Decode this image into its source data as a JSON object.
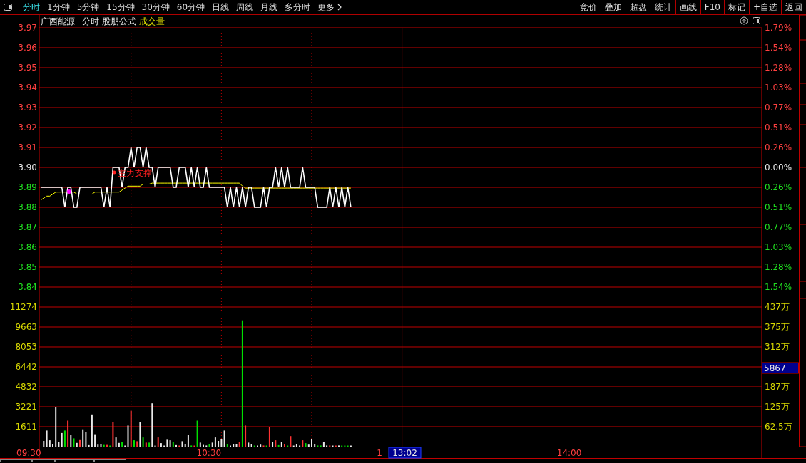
{
  "toolbar": {
    "tabs": [
      {
        "label": "分时",
        "selected": true
      },
      {
        "label": "1分钟",
        "selected": false
      },
      {
        "label": "5分钟",
        "selected": false
      },
      {
        "label": "15分钟",
        "selected": false
      },
      {
        "label": "30分钟",
        "selected": false
      },
      {
        "label": "60分钟",
        "selected": false
      },
      {
        "label": "日线",
        "selected": false
      },
      {
        "label": "周线",
        "selected": false
      },
      {
        "label": "月线",
        "selected": false
      },
      {
        "label": "多分时",
        "selected": false
      }
    ],
    "more": "更多",
    "buttons": [
      "竞价",
      "叠加",
      "超盘",
      "统计",
      "画线",
      "F10",
      "标记",
      "+自选",
      "返回"
    ]
  },
  "chart_header": [
    {
      "text": "广西能源",
      "kind": "title"
    },
    {
      "text": "分时",
      "kind": "label"
    },
    {
      "text": "股朋公式",
      "kind": "label"
    },
    {
      "text": "成交量",
      "kind": "indicator"
    }
  ],
  "price_chart": {
    "chart_data": {
      "type": "line",
      "grid": true,
      "ylim": [
        3.84,
        3.97
      ],
      "categories": [
        null,
        null,
        null,
        null,
        null,
        null,
        null,
        null,
        null,
        null,
        null,
        null,
        null,
        null,
        null,
        null,
        null,
        null,
        null,
        null,
        null,
        null,
        null,
        null,
        null,
        null,
        null,
        null,
        null,
        null,
        null,
        null,
        null,
        null,
        null,
        null,
        null,
        null,
        null,
        null,
        null,
        null,
        null,
        null,
        null,
        null,
        null,
        null,
        null,
        null,
        null,
        null,
        null,
        null,
        null,
        null,
        null,
        null,
        null,
        null,
        null,
        null,
        null,
        null,
        null,
        null,
        null,
        null,
        null,
        null,
        null,
        null,
        null,
        null,
        null,
        null,
        null,
        null,
        null,
        null,
        null,
        null,
        null,
        null,
        null,
        null,
        null,
        null,
        null,
        null,
        null,
        null,
        null,
        null,
        null,
        null,
        null,
        null,
        null,
        null,
        null,
        null,
        null,
        null,
        null,
        null,
        null,
        null,
        null,
        null,
        null,
        null,
        null,
        null,
        null,
        null,
        null,
        null,
        null,
        null,
        null,
        null,
        null,
        null,
        null,
        null,
        null,
        null,
        null,
        null,
        null,
        null,
        null,
        null,
        null,
        null,
        null,
        null,
        null,
        null,
        null,
        null,
        null,
        null,
        null,
        null,
        null,
        null,
        null,
        null,
        null,
        null,
        null,
        null,
        null,
        null,
        null,
        null,
        null,
        null,
        null,
        null,
        null,
        null,
        null,
        null,
        null,
        null,
        null,
        null,
        null,
        null,
        null,
        null,
        null,
        null,
        null,
        null,
        null,
        null,
        null,
        null,
        null,
        null,
        null,
        null,
        null,
        null,
        null,
        null,
        null,
        null,
        null,
        null,
        null,
        null,
        null,
        null,
        null,
        null,
        null,
        null,
        null,
        null,
        null,
        null,
        null,
        null,
        null,
        null,
        null,
        null,
        null,
        null,
        null,
        null,
        null,
        null,
        null,
        null,
        null,
        null,
        null,
        null,
        null,
        null,
        null,
        null,
        null,
        null,
        null,
        null,
        null,
        null,
        null,
        null,
        null,
        null,
        null,
        null
      ],
      "series": [
        {
          "color": "#ffffff",
          "values": [
            3.89,
            3.89,
            3.89,
            3.89,
            3.89,
            3.89,
            3.89,
            3.89,
            3.88,
            3.89,
            3.89,
            3.88,
            3.88,
            3.89,
            3.89,
            3.89,
            3.89,
            3.89,
            3.89,
            3.89,
            3.89,
            3.88,
            3.89,
            3.88,
            3.9,
            3.9,
            3.9,
            3.89,
            3.9,
            3.9,
            3.91,
            3.9,
            3.91,
            3.91,
            3.9,
            3.91,
            3.9,
            3.9,
            3.89,
            3.9,
            3.9,
            3.9,
            3.9,
            3.9,
            3.89,
            3.89,
            3.9,
            3.9,
            3.9,
            3.89,
            3.9,
            3.89,
            3.9,
            3.89,
            3.89,
            3.9,
            3.89,
            3.89,
            3.89,
            3.89,
            3.89,
            3.89,
            3.88,
            3.89,
            3.88,
            3.89,
            3.88,
            3.89,
            3.88,
            3.89,
            3.89,
            3.88,
            3.88,
            3.88,
            3.89,
            3.88,
            3.89,
            3.89,
            3.9,
            3.89,
            3.9,
            3.89,
            3.9,
            3.89,
            3.89,
            3.89,
            3.89,
            3.9,
            3.89,
            3.89,
            3.89,
            3.89,
            3.88,
            3.88,
            3.88,
            3.88,
            3.89,
            3.88,
            3.89,
            3.88,
            3.89,
            3.88,
            3.89,
            3.88,
            null,
            null,
            null,
            null,
            null,
            null,
            null,
            null,
            null,
            null,
            null,
            null,
            null,
            null,
            null,
            null,
            null,
            null,
            null,
            null,
            null,
            null,
            null,
            null,
            null,
            null,
            null,
            null,
            null,
            null,
            null,
            null,
            null,
            null,
            null,
            null,
            null,
            null,
            null,
            null,
            null,
            null,
            null,
            null,
            null,
            null,
            null,
            null,
            null,
            null,
            null,
            null,
            null,
            null,
            null,
            null,
            null,
            null,
            null,
            null,
            null,
            null,
            null,
            null,
            null,
            null,
            null,
            null,
            null,
            null,
            null,
            null,
            null,
            null,
            null,
            null,
            null,
            null,
            null,
            null,
            null,
            null,
            null,
            null,
            null,
            null,
            null,
            null,
            null,
            null,
            null,
            null,
            null,
            null,
            null,
            null,
            null,
            null,
            null,
            null,
            null,
            null,
            null,
            null,
            null,
            null,
            null,
            null,
            null,
            null,
            null,
            null,
            null,
            null,
            null,
            null,
            null,
            null,
            null,
            null,
            null,
            null,
            null,
            null,
            null,
            null,
            null,
            null,
            null,
            null,
            null,
            null,
            null,
            null,
            null,
            null
          ]
        },
        {
          "color": "#ffff00",
          "values": [
            3.884,
            3.885,
            3.886,
            3.886,
            3.887,
            3.888,
            3.888,
            3.888,
            3.888,
            3.888,
            3.888,
            3.888,
            3.887,
            3.887,
            3.887,
            3.887,
            3.887,
            3.887,
            3.888,
            3.888,
            3.888,
            3.888,
            3.888,
            3.888,
            3.888,
            3.888,
            3.888,
            3.889,
            3.89,
            3.891,
            3.891,
            3.891,
            3.891,
            3.891,
            3.892,
            3.892,
            3.892,
            3.8925,
            3.8925,
            3.8925,
            3.8925,
            3.8925,
            3.8925,
            3.8925,
            3.8925,
            3.8925,
            3.8925,
            3.8925,
            3.8925,
            3.8925,
            3.8925,
            3.8925,
            3.8925,
            3.8925,
            3.8925,
            3.8925,
            3.8925,
            3.8925,
            3.8925,
            3.8925,
            3.8925,
            3.8925,
            3.8925,
            3.8925,
            3.8925,
            3.8925,
            3.8925,
            3.891,
            3.89,
            3.89,
            3.89,
            3.89,
            3.89,
            3.89,
            3.89,
            3.89,
            3.89,
            3.89,
            3.89,
            3.89,
            3.89,
            3.89,
            3.89,
            3.89,
            3.89,
            3.89,
            3.89,
            3.89,
            3.89,
            3.89,
            3.89,
            3.89,
            3.89,
            3.89,
            3.89,
            3.89,
            3.89,
            3.89,
            3.89,
            3.89,
            3.89,
            3.89,
            3.89,
            3.89,
            null,
            null,
            null,
            null,
            null,
            null,
            null,
            null,
            null,
            null,
            null,
            null,
            null,
            null,
            null,
            null,
            null,
            null,
            null,
            null,
            null,
            null,
            null,
            null,
            null,
            null,
            null,
            null,
            null,
            null,
            null,
            null,
            null,
            null,
            null,
            null,
            null,
            null,
            null,
            null,
            null,
            null,
            null,
            null,
            null,
            null,
            null,
            null,
            null,
            null,
            null,
            null,
            null,
            null,
            null,
            null,
            null,
            null,
            null,
            null,
            null,
            null,
            null,
            null,
            null,
            null,
            null,
            null,
            null,
            null,
            null,
            null,
            null,
            null,
            null,
            null,
            null,
            null,
            null,
            null,
            null,
            null,
            null,
            null,
            null,
            null,
            null,
            null,
            null,
            null,
            null,
            null,
            null,
            null,
            null,
            null,
            null,
            null,
            null,
            null,
            null,
            null,
            null,
            null,
            null,
            null,
            null,
            null,
            null,
            null,
            null,
            null,
            null,
            null,
            null,
            null,
            null,
            null,
            null,
            null,
            null,
            null,
            null,
            null,
            null,
            null,
            null,
            null,
            null,
            null,
            null,
            null,
            null,
            null,
            null,
            null
          ]
        }
      ],
      "yticks": [
        {
          "value": 3.97,
          "label": "3.97"
        },
        {
          "value": 3.96,
          "label": "3.96"
        },
        {
          "value": 3.95,
          "label": "3.95"
        },
        {
          "value": 3.94,
          "label": "3.94"
        },
        {
          "value": 3.93,
          "label": "3.93"
        },
        {
          "value": 3.92,
          "label": "3.92"
        },
        {
          "value": 3.91,
          "label": "3.91"
        },
        {
          "value": 3.9,
          "label": "3.90"
        },
        {
          "value": 3.89,
          "label": "3.89"
        },
        {
          "value": 3.88,
          "label": "3.88"
        },
        {
          "value": 3.87,
          "label": "3.87"
        },
        {
          "value": 3.86,
          "label": "3.86"
        },
        {
          "value": 3.85,
          "label": "3.85"
        },
        {
          "value": 3.84,
          "label": "3.84"
        }
      ],
      "annotations": [
        "主力支撑"
      ]
    },
    "percent_axis": [
      {
        "text": "1.79%",
        "color": "#ff4040"
      },
      {
        "text": "1.54%",
        "color": "#ff4040"
      },
      {
        "text": "1.28%",
        "color": "#ff4040"
      },
      {
        "text": "1.03%",
        "color": "#ff4040"
      },
      {
        "text": "0.77%",
        "color": "#ff4040"
      },
      {
        "text": "0.51%",
        "color": "#ff4040"
      },
      {
        "text": "0.26%",
        "color": "#ff4040"
      },
      {
        "text": "0.00%",
        "color": "#e8e8e8"
      },
      {
        "text": "0.26%",
        "color": "#20e020"
      },
      {
        "text": "0.51%",
        "color": "#20e020"
      },
      {
        "text": "0.77%",
        "color": "#20e020"
      },
      {
        "text": "1.03%",
        "color": "#20e020"
      },
      {
        "text": "1.28%",
        "color": "#20e020"
      },
      {
        "text": "1.54%",
        "color": "#20e020"
      }
    ]
  },
  "volume_chart": {
    "chart_data": {
      "type": "bar",
      "grid": true,
      "ylim": [
        0,
        11274
      ],
      "categories": [
        null,
        null,
        null,
        null,
        null,
        null,
        null,
        null,
        null,
        null,
        null,
        null,
        null,
        null,
        null,
        null,
        null,
        null,
        null,
        null,
        null,
        null,
        null,
        null,
        null,
        null,
        null,
        null,
        null,
        null,
        null,
        null,
        null,
        null,
        null,
        null,
        null,
        null,
        null,
        null,
        null,
        null,
        null,
        null,
        null,
        null,
        null,
        null,
        null,
        null,
        null,
        null,
        null,
        null,
        null,
        null,
        null,
        null,
        null,
        null,
        null,
        null,
        null,
        null,
        null,
        null,
        null,
        null,
        null,
        null,
        null,
        null,
        null,
        null,
        null,
        null,
        null,
        null,
        null,
        null,
        null,
        null,
        null,
        null,
        null,
        null,
        null,
        null,
        null,
        null,
        null,
        null,
        null,
        null,
        null,
        null,
        null,
        null,
        null,
        null,
        null,
        null,
        null,
        null,
        null,
        null,
        null,
        null,
        null,
        null,
        null,
        null,
        null,
        null,
        null,
        null,
        null,
        null,
        null,
        null,
        null,
        null,
        null,
        null,
        null,
        null,
        null,
        null,
        null,
        null,
        null,
        null,
        null,
        null,
        null,
        null,
        null,
        null,
        null,
        null,
        null,
        null,
        null,
        null,
        null,
        null,
        null,
        null,
        null,
        null,
        null,
        null,
        null,
        null,
        null,
        null,
        null,
        null,
        null,
        null,
        null,
        null,
        null,
        null,
        null,
        null,
        null,
        null,
        null,
        null,
        null,
        null,
        null,
        null,
        null,
        null,
        null,
        null,
        null,
        null,
        null,
        null,
        null,
        null,
        null,
        null,
        null,
        null,
        null,
        null,
        null,
        null,
        null,
        null,
        null,
        null,
        null,
        null,
        null,
        null,
        null,
        null,
        null,
        null,
        null,
        null,
        null,
        null,
        null,
        null,
        null,
        null,
        null,
        null,
        null,
        null,
        null,
        null,
        null,
        null,
        null,
        null,
        null,
        null,
        null,
        null,
        null,
        null,
        null,
        null,
        null,
        null,
        null,
        null,
        null,
        null,
        null,
        null,
        null,
        null
      ],
      "series": [
        {
          "color": "#e8e8e8",
          "values": [
            null,
            460,
            1300,
            510,
            230,
            3200,
            390,
            1100,
            null,
            null,
            920,
            null,
            300,
            null,
            1400,
            1200,
            120,
            2600,
            1000,
            160,
            230,
            null,
            null,
            null,
            null,
            740,
            300,
            null,
            50,
            1700,
            null,
            null,
            null,
            2000,
            null,
            null,
            null,
            3500,
            50,
            null,
            280,
            50,
            550,
            510,
            null,
            120,
            null,
            440,
            230,
            920,
            null,
            null,
            null,
            320,
            140,
            90,
            null,
            320,
            740,
            460,
            620,
            1300,
            null,
            50,
            230,
            230,
            null,
            null,
            null,
            320,
            230,
            null,
            50,
            160,
            null,
            null,
            null,
            390,
            null,
            null,
            390,
            null,
            null,
            null,
            50,
            230,
            50,
            null,
            null,
            160,
            620,
            230,
            null,
            null,
            390,
            90,
            null,
            50,
            null,
            90,
            null,
            null,
            null,
            20,
            null,
            null,
            null,
            null,
            null,
            null,
            null,
            null,
            null,
            null,
            null,
            null,
            null,
            null,
            null,
            null,
            null,
            null,
            null,
            null,
            null,
            null,
            null,
            null,
            null,
            null,
            null,
            null,
            null,
            null,
            null,
            null,
            null,
            null,
            null,
            null,
            null,
            null,
            null,
            null,
            null,
            null,
            null,
            null,
            null,
            null,
            null,
            null,
            null,
            null,
            null,
            null,
            null,
            null,
            null,
            null,
            null,
            null,
            null,
            null,
            null,
            null,
            null,
            null,
            null,
            null,
            null,
            null,
            null,
            null,
            null,
            null,
            null,
            null,
            null,
            null,
            null,
            null,
            null,
            null,
            null,
            null,
            null,
            null,
            null,
            null,
            null,
            null,
            null,
            null,
            null,
            null,
            null,
            null,
            null,
            null,
            null,
            null,
            null,
            null,
            null,
            null,
            null,
            null,
            null,
            null,
            null,
            null,
            null,
            null,
            null,
            null,
            null,
            null,
            null,
            null,
            null,
            null,
            null,
            null,
            null,
            null,
            null,
            null,
            null,
            null,
            null,
            null,
            null,
            null,
            null,
            null,
            null,
            null,
            null,
            null
          ]
        },
        {
          "color": "#ff3232",
          "values": [
            null,
            null,
            null,
            null,
            null,
            null,
            null,
            null,
            null,
            2100,
            null,
            null,
            null,
            530,
            null,
            null,
            null,
            null,
            null,
            null,
            null,
            null,
            140,
            null,
            2000,
            null,
            null,
            null,
            null,
            null,
            2900,
            null,
            440,
            null,
            null,
            320,
            null,
            null,
            null,
            740,
            null,
            null,
            null,
            null,
            null,
            null,
            50,
            null,
            null,
            null,
            null,
            50,
            null,
            null,
            null,
            null,
            null,
            null,
            null,
            null,
            null,
            null,
            null,
            null,
            null,
            null,
            390,
            null,
            1700,
            null,
            null,
            null,
            null,
            null,
            90,
            null,
            1600,
            null,
            510,
            null,
            null,
            230,
            null,
            850,
            null,
            null,
            null,
            510,
            null,
            null,
            null,
            null,
            null,
            null,
            null,
            null,
            90,
            null,
            50,
            null,
            null,
            null,
            null,
            null,
            null,
            null,
            null,
            null,
            null,
            null,
            null,
            null,
            null,
            null,
            null,
            null,
            null,
            null,
            null,
            null,
            null,
            null,
            null,
            null,
            null,
            null,
            null,
            null,
            null,
            null,
            null,
            null,
            null,
            null,
            null,
            null,
            null,
            null,
            null,
            null,
            null,
            null,
            null,
            null,
            null,
            null,
            null,
            null,
            null,
            null,
            null,
            null,
            null,
            null,
            null,
            null,
            null,
            null,
            null,
            null,
            null,
            null,
            null,
            null,
            null,
            null,
            null,
            null,
            null,
            null,
            null,
            null,
            null,
            null,
            null,
            null,
            null,
            null,
            null,
            null,
            null,
            null,
            null,
            null,
            null,
            null,
            null,
            null,
            null,
            null,
            null,
            null,
            null,
            null,
            null,
            null,
            null,
            null,
            null,
            null,
            null,
            null,
            null,
            null,
            null,
            null,
            null,
            null,
            null,
            null,
            null,
            null,
            null,
            null,
            null,
            null,
            null,
            null,
            null,
            null,
            null,
            null,
            null,
            null,
            null,
            null,
            null,
            null,
            null,
            null,
            null,
            null,
            null,
            null,
            null,
            null,
            null,
            null,
            null,
            null
          ]
        },
        {
          "color": "#00e000",
          "values": [
            null,
            null,
            null,
            null,
            null,
            null,
            null,
            null,
            1300,
            null,
            null,
            670,
            null,
            null,
            null,
            null,
            null,
            null,
            null,
            null,
            null,
            140,
            null,
            70,
            null,
            null,
            null,
            390,
            null,
            null,
            null,
            510,
            null,
            null,
            740,
            null,
            320,
            null,
            null,
            null,
            null,
            null,
            null,
            null,
            390,
            null,
            null,
            null,
            null,
            null,
            90,
            null,
            2100,
            null,
            null,
            null,
            230,
            null,
            null,
            null,
            null,
            null,
            230,
            null,
            null,
            null,
            null,
            10200,
            null,
            null,
            null,
            50,
            null,
            null,
            null,
            50,
            null,
            null,
            null,
            120,
            null,
            null,
            50,
            null,
            null,
            null,
            null,
            null,
            280,
            null,
            null,
            null,
            90,
            90,
            null,
            null,
            null,
            null,
            null,
            null,
            20,
            20,
            20,
            null,
            null,
            null,
            null,
            null,
            null,
            null,
            null,
            null,
            null,
            null,
            null,
            null,
            null,
            null,
            null,
            null,
            null,
            null,
            null,
            null,
            null,
            null,
            null,
            null,
            null,
            null,
            null,
            null,
            null,
            null,
            null,
            null,
            null,
            null,
            null,
            null,
            null,
            null,
            null,
            null,
            null,
            null,
            null,
            null,
            null,
            null,
            null,
            null,
            null,
            null,
            null,
            null,
            null,
            null,
            null,
            null,
            null,
            null,
            null,
            null,
            null,
            null,
            null,
            null,
            null,
            null,
            null,
            null,
            null,
            null,
            null,
            null,
            null,
            null,
            null,
            null,
            null,
            null,
            null,
            null,
            null,
            null,
            null,
            null,
            null,
            null,
            null,
            null,
            null,
            null,
            null,
            null,
            null,
            null,
            null,
            null,
            null,
            null,
            null,
            null,
            null,
            null,
            null,
            null,
            null,
            null,
            null,
            null,
            null,
            null,
            null,
            null,
            null,
            null,
            null,
            null,
            null,
            null,
            null,
            null,
            null,
            null,
            null,
            null,
            null,
            null,
            null,
            null,
            null,
            null,
            null,
            null,
            null,
            null,
            null,
            null
          ]
        }
      ],
      "yticks": [
        {
          "value": 11274,
          "label": "11274"
        },
        {
          "value": 9663,
          "label": "9663"
        },
        {
          "value": 8053,
          "label": "8053"
        },
        {
          "value": 6442,
          "label": "6442"
        },
        {
          "value": 4832,
          "label": "4832"
        },
        {
          "value": 3221,
          "label": "3221"
        },
        {
          "value": 1611,
          "label": "1611"
        }
      ]
    },
    "amount_axis": [
      "437万",
      "375万",
      "312万",
      "187万",
      "125万",
      "62.5万"
    ]
  },
  "time_axis": [
    "09:30",
    "10:30",
    "1",
    "14:00"
  ],
  "cursor": {
    "time": "13:02",
    "value": "5867"
  }
}
